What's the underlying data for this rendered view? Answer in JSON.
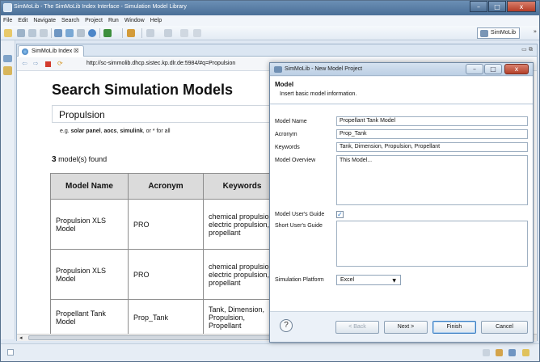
{
  "window": {
    "title": "SimMoLib - The SimMoLib Index Interface - Simulation Model Library",
    "buttons": [
      "–",
      "□",
      "x"
    ]
  },
  "menu": [
    "File",
    "Edit",
    "Navigate",
    "Search",
    "Project",
    "Run",
    "Window",
    "Help"
  ],
  "perspective": {
    "label": "SimMoLib",
    "overflow": "»"
  },
  "editor": {
    "tab_label": "SimMoLib Index ☒",
    "minmax": "▭ ⧉",
    "url": "http://sc-simmolib.dhcp.sistec.kp.dlr.de:5984/#q=Propulsion"
  },
  "page": {
    "title": "Search Simulation Models",
    "search_value": "Propulsion",
    "hint_prefix": "e.g. ",
    "hint_ex1": "solar panel",
    "hint_sep1": ", ",
    "hint_ex2": "aocs",
    "hint_sep2": ", ",
    "hint_ex3": "simulink",
    "hint_suffix": ", or * for all",
    "found_count": "3",
    "found_suffix": " model(s) found",
    "columns": [
      "Model Name",
      "Acronym",
      "Keywords"
    ],
    "rows": [
      {
        "name": "Propulsion XLS Model",
        "acronym": "PRO",
        "keywords": "chemical propulsion, electric propulsion, propellant"
      },
      {
        "name": "Propulsion XLS Model",
        "acronym": "PRO",
        "keywords": "chemical propulsion, electric propulsion, propellant"
      },
      {
        "name": "Propellant Tank Model",
        "acronym": "Prop_Tank",
        "keywords": "Tank, Dimension, Propulsion, Propellant"
      }
    ]
  },
  "dialog": {
    "title": "SimMoLib - New Model Project",
    "heading": "Model",
    "subheading": "Insert basic model information.",
    "fields": {
      "model_name_label": "Model Name",
      "model_name_value": "Propellant Tank Model",
      "acronym_label": "Acronym",
      "acronym_value": "Prop_Tank",
      "keywords_label": "Keywords",
      "keywords_value": "Tank, Dimension, Propulsion, Propellant",
      "overview_label": "Model Overview",
      "overview_value": "This Model...",
      "users_guide_label": "Model User's Guide",
      "users_guide_checked": "✓",
      "short_guide_label": "Short User's Guide",
      "short_guide_value": "",
      "platform_label": "Simulation Platform",
      "platform_value": "Excel"
    },
    "buttons": {
      "help": "?",
      "back": "< Back",
      "next": "Next >",
      "finish": "Finish",
      "cancel": "Cancel"
    }
  }
}
